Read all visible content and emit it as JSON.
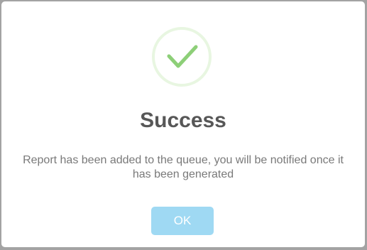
{
  "dialog": {
    "icon": "success-check-icon",
    "title": "Success",
    "message": "Report has been added to the queue, you will be notified once it has been generated",
    "ok_label": "OK"
  },
  "colors": {
    "check": "#8dcf78",
    "ring": "#e7f4e0",
    "ok_button": "#9fd9f3",
    "title": "#575757",
    "message": "#797979"
  }
}
